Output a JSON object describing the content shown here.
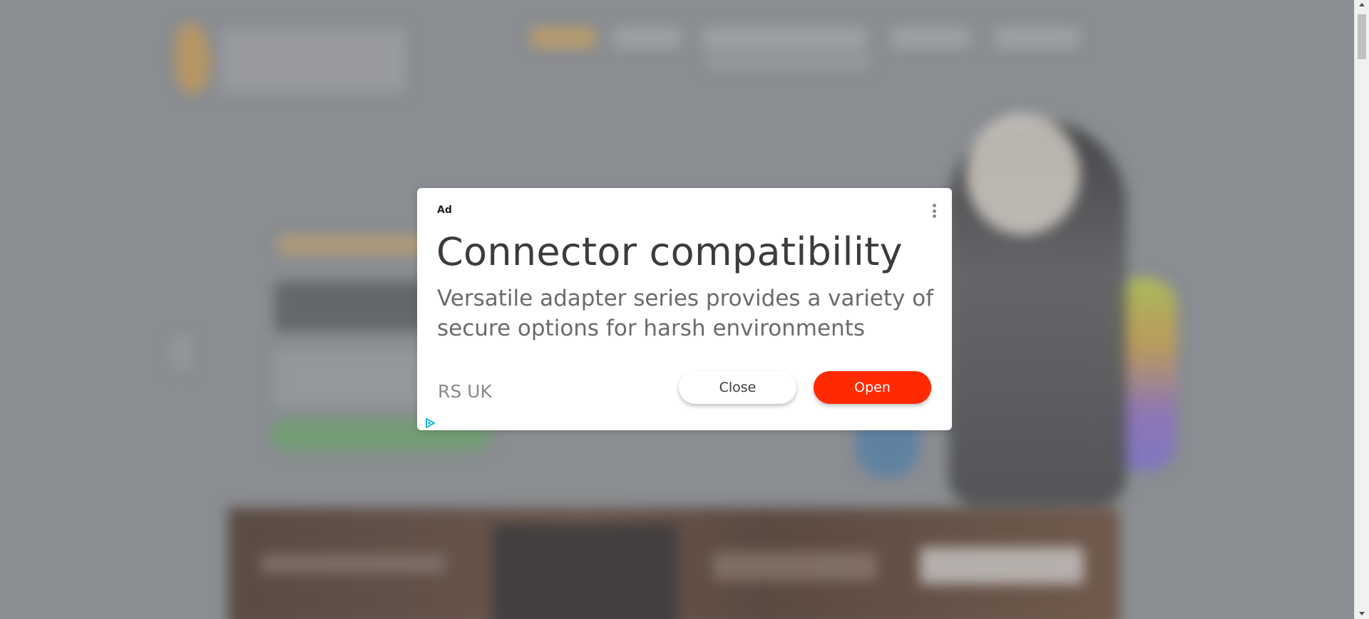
{
  "ad": {
    "label": "Ad",
    "title": "Connector compatibility",
    "body": "Versatile adapter series provides a variety of secure options for harsh environments",
    "advertiser": "RS UK",
    "close_label": "Close",
    "open_label": "Open",
    "open_color": "#ff2a00",
    "icons": [
      "more-options-icon",
      "adchoices-icon"
    ]
  },
  "colors": {
    "overlay": "#8a8d91",
    "dialog_bg": "#ffffff"
  }
}
